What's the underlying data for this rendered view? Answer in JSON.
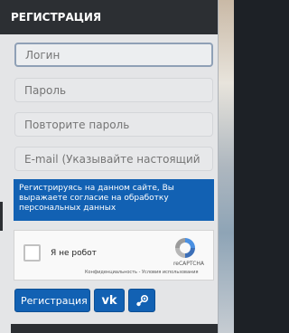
{
  "header": {
    "title": "РЕГИСТРАЦИЯ"
  },
  "form": {
    "login_placeholder": "Логин",
    "password_placeholder": "Пароль",
    "repeat_password_placeholder": "Повторите пароль",
    "email_placeholder": "E-mail (Указывайте настоящий e-m"
  },
  "notice": {
    "text": "Регистрируясь на данном сайте, Вы выражаете согласие на обработку персональных данных"
  },
  "captcha": {
    "label": "Я не робот",
    "brand": "reCAPTCHA",
    "links": "Конфиденциальность - Условия использования"
  },
  "buttons": {
    "register": "Регистрация",
    "vk": "vk",
    "steam_icon": "steam-icon"
  },
  "colors": {
    "header_bg": "#2c2f33",
    "accent": "#1261b3",
    "panel_bg": "#e4e5e7"
  }
}
